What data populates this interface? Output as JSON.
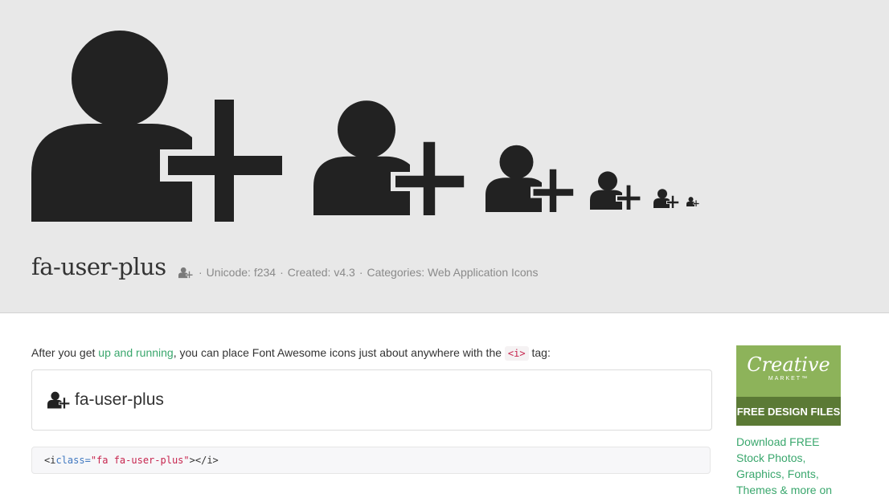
{
  "icon": {
    "name": "fa-user-plus",
    "unicode_label": "Unicode:",
    "unicode_value": "f234",
    "created_label": "Created:",
    "created_value": "v4.3",
    "categories_label": "Categories:",
    "categories_value": "Web Application Icons",
    "separator": "·"
  },
  "intro": {
    "before": "After you get ",
    "link": "up and running",
    "middle": ", you can place Font Awesome icons just about anywhere with the ",
    "code": "<i>",
    "after": " tag:"
  },
  "example": {
    "label": "fa-user-plus"
  },
  "code_snippet": {
    "open_tag": "<i ",
    "attr_name": "class=",
    "attr_value": "\"fa fa-user-plus\"",
    "close": "></i>"
  },
  "ad": {
    "brand": "Creative",
    "brand_sub": "MARKET™",
    "banner": "FREE DESIGN FILES",
    "text": "Download FREE Stock Photos, Graphics, Fonts, Themes & more on"
  },
  "colors": {
    "hero_bg": "#e8e8e8",
    "icon": "#222222",
    "link": "#3aa76d",
    "ad_green": "#8db35a",
    "ad_dark_green": "#5b7a35"
  }
}
